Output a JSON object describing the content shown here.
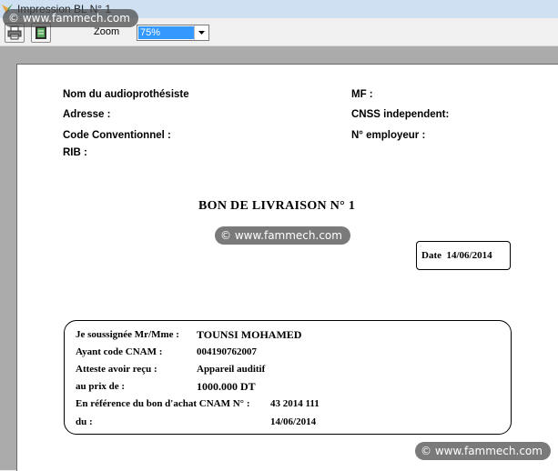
{
  "window": {
    "title": "Impression BL N° 1"
  },
  "toolbar": {
    "zoom_label": "Zoom",
    "zoom_value": "75%"
  },
  "header": {
    "left": [
      "Nom du audioprothésiste",
      "Adresse :",
      "Code Conventionnel :",
      "RIB :"
    ],
    "right": [
      "MF :",
      "CNSS independent:",
      "N° employeur :"
    ]
  },
  "document": {
    "title": "BON DE LIVRAISON N° 1"
  },
  "date_box": {
    "label": "Date",
    "value": "14/06/2014"
  },
  "info": {
    "name_label": "Je soussignée Mr/Mme :",
    "name_value": "TOUNSI MOHAMED",
    "cnam_label": "Ayant code CNAM :",
    "cnam_value": "004190762007",
    "recu_label": "Atteste avoir reçu :",
    "recu_value": "Appareil auditif",
    "prix_label": "au prix de :",
    "prix_value": "1000.000 DT",
    "ref_label": "En référence du bon d'achat CNAM N° :",
    "ref_value": "43  2014  111",
    "du_label": "du :",
    "du_value": "14/06/2014"
  },
  "watermark": {
    "text": "© www.fammech.com"
  }
}
